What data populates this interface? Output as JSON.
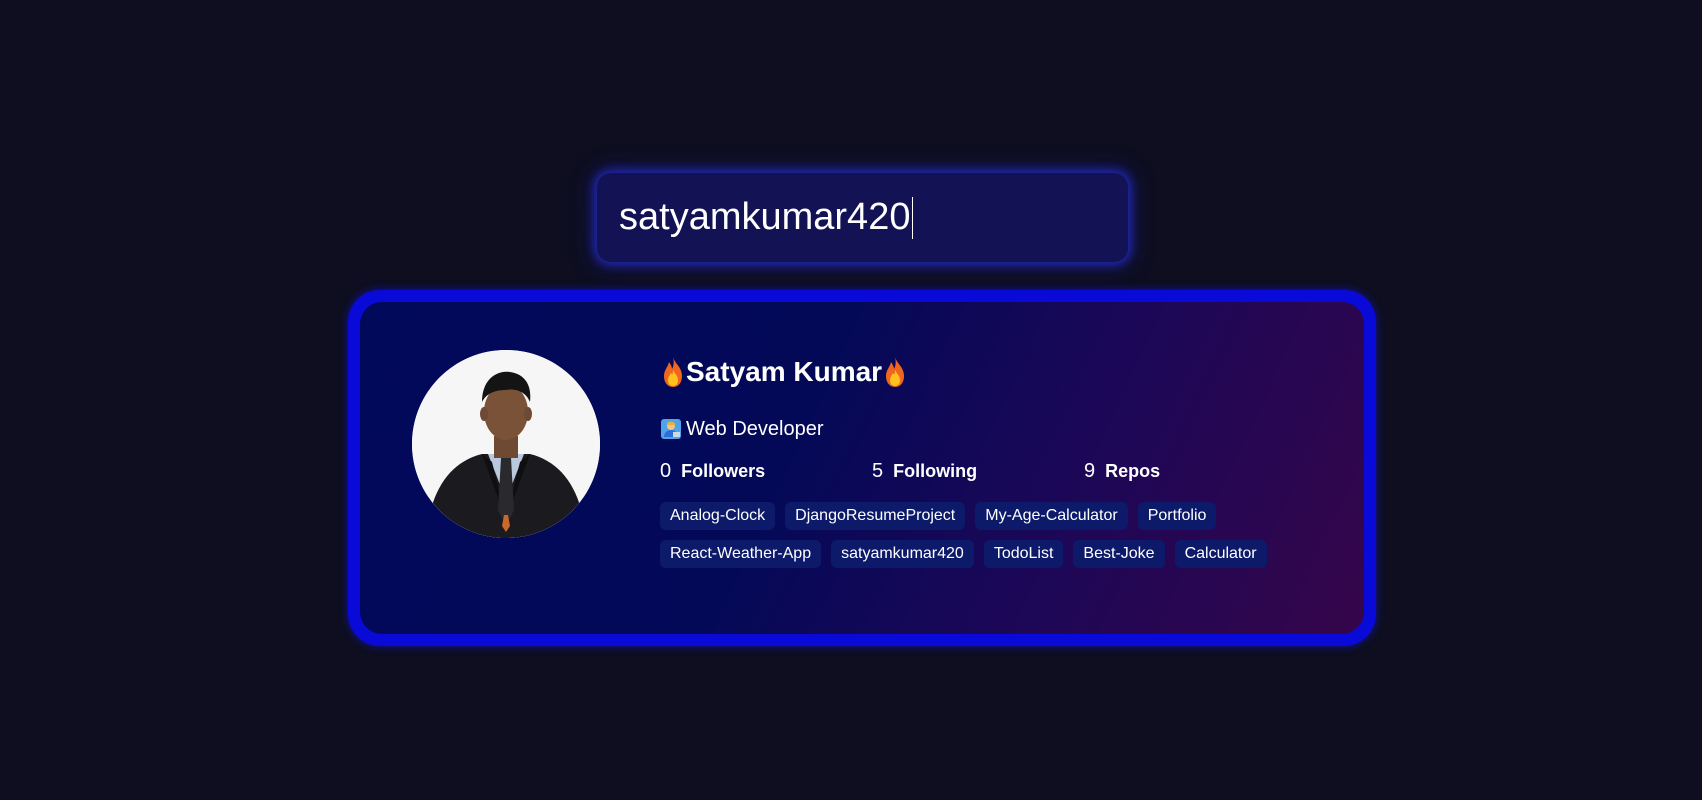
{
  "search": {
    "value": "satyamkumar420"
  },
  "profile": {
    "name": "Satyam Kumar",
    "name_prefix_icon": "fire-icon",
    "name_suffix_icon": "fire-icon",
    "bio": "Web Developer",
    "bio_icon": "person-at-laptop-icon",
    "avatar_alt": "profile-photo"
  },
  "stats": [
    {
      "value": "0",
      "label": "Followers"
    },
    {
      "value": "5",
      "label": "Following"
    },
    {
      "value": "9",
      "label": "Repos"
    }
  ],
  "repos": [
    "Analog-Clock",
    "DjangoResumeProject",
    "My-Age-Calculator",
    "Portfolio",
    "React-Weather-App",
    "satyamkumar420",
    "TodoList",
    "Best-Joke",
    "Calculator"
  ],
  "colors": {
    "page_background": "#0e0e20",
    "search_background": "#121255",
    "card_border": "#0a0ad8",
    "repo_tag_background": "#0d1a6a"
  }
}
